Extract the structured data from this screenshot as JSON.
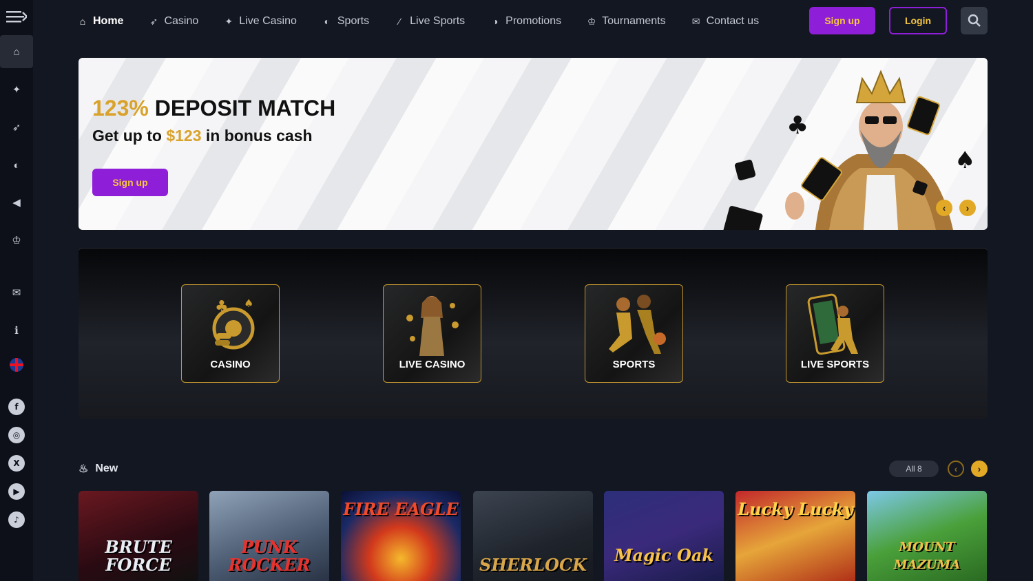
{
  "nav": {
    "items": [
      {
        "label": "Home",
        "icon": "home-icon",
        "active": true
      },
      {
        "label": "Casino",
        "icon": "rocket-icon"
      },
      {
        "label": "Live Casino",
        "icon": "gamepad-icon"
      },
      {
        "label": "Sports",
        "icon": "ball-icon"
      },
      {
        "label": "Live Sports",
        "icon": "wand-icon"
      },
      {
        "label": "Promotions",
        "icon": "gift-icon"
      },
      {
        "label": "Tournaments",
        "icon": "trophy-icon"
      },
      {
        "label": "Contact us",
        "icon": "chat-icon"
      }
    ],
    "signup": "Sign up",
    "login": "Login"
  },
  "banner": {
    "headline_accent": "123%",
    "headline_rest": "DEPOSIT MATCH",
    "sub_before": "Get up to",
    "sub_accent": "$123",
    "sub_after": "in bonus cash",
    "cta": "Sign up"
  },
  "categories": [
    {
      "label": "CASINO"
    },
    {
      "label": "LIVE CASINO"
    },
    {
      "label": "SPORTS"
    },
    {
      "label": "LIVE SPORTS"
    }
  ],
  "new_section": {
    "title": "New",
    "all_label": "All 8"
  },
  "games": [
    {
      "title": "BRUTE FORCE"
    },
    {
      "title": "PUNK ROCKER"
    },
    {
      "title": "FIRE EAGLE"
    },
    {
      "title": "SHERLOCK"
    },
    {
      "title": "Magic Oak"
    },
    {
      "title": "Lucky Lucky"
    },
    {
      "title": "MOUNT MAZUMA"
    }
  ],
  "colors": {
    "accent_purple": "#8f1ed8",
    "accent_gold": "#e1a926",
    "background": "#131722"
  }
}
